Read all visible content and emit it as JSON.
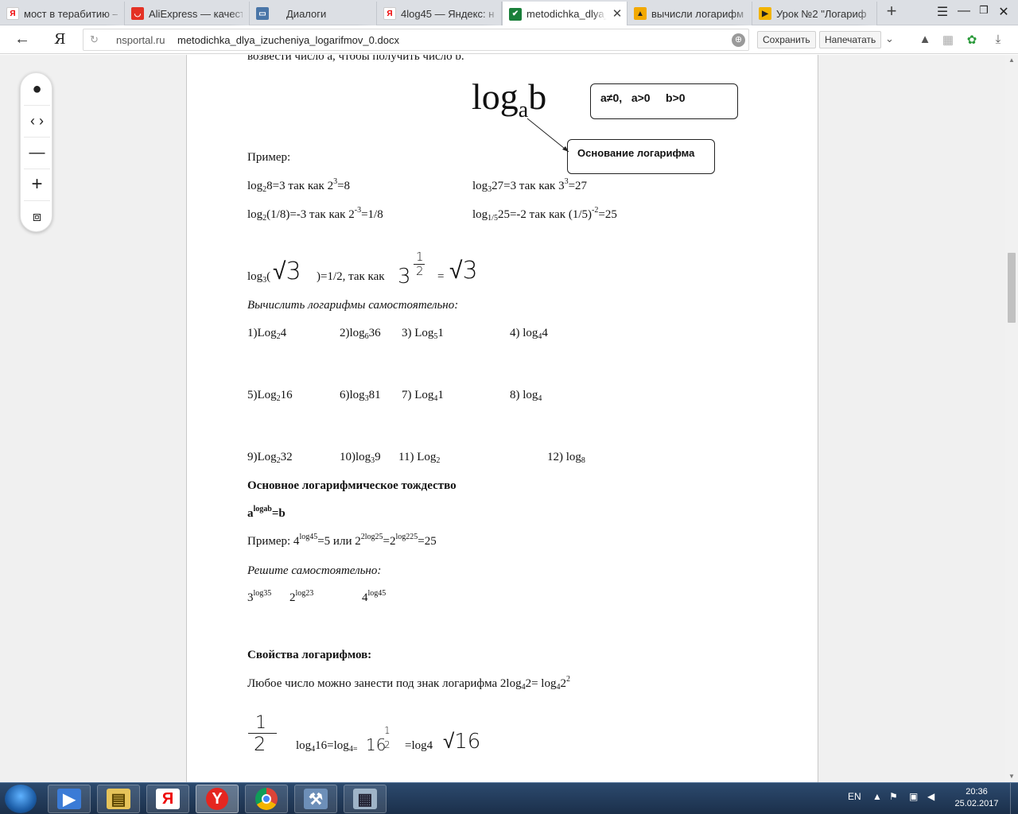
{
  "tabs": [
    {
      "title": "мост в терабитию —",
      "icon": "yandex-icon",
      "color": "#e8e8e8"
    },
    {
      "title": "AliExpress — качеств",
      "icon": "aliexpress-icon",
      "color": "#e43225"
    },
    {
      "title": "Диалоги",
      "icon": "chat-icon",
      "color": "#4a76a8"
    },
    {
      "title": "4log45 — Яндекс: на",
      "icon": "yandex-icon",
      "color": "#e8e8e8"
    },
    {
      "title": "metodichka_dlya_i",
      "icon": "check-icon",
      "color": "#1a7f3a",
      "active": true
    },
    {
      "title": "вычисли логарифм к",
      "icon": "image-icon",
      "color": "#f2a900"
    },
    {
      "title": "Урок №2 \"Логариф",
      "icon": "play-icon",
      "color": "#f2b400"
    }
  ],
  "address": {
    "domain": "nsportal.ru",
    "path": "metodichka_dlya_izucheniya_logarifmov_0.docx",
    "save_label": "Сохранить",
    "print_label": "Напечатать"
  },
  "doc": {
    "line_top": "возвести число a, чтобы получить число b.",
    "big_log": "log",
    "big_base": "a",
    "big_arg": "b",
    "cond_box": "a≠0,   a>0     b>0",
    "base_box": "Основание логарифма",
    "example_label": "Пример:",
    "ex1_a": {
      "log": "log",
      "base": "2",
      "rest": "8=3 так как 2",
      "exp": "3",
      "end": "=8"
    },
    "ex1_b": {
      "log": "log",
      "base": "3",
      "rest": "27=3 так как 3",
      "exp": "3",
      "end": "=27"
    },
    "ex2_a": {
      "log": "log",
      "base": "2",
      "rest": "(1/8)=-3 так как 2",
      "exp": "-3",
      "end": "=1/8"
    },
    "ex2_b": {
      "log": "log",
      "base": "1/5",
      "rest": "25=-2 так как (1/5)",
      "exp": "-2",
      "end": "=25"
    },
    "ex3": {
      "log": "log",
      "base": "3",
      "open": "(",
      "hand_root": "√3",
      "rest": ")=1/2, так как",
      "hand_three": "3",
      "hand_half_num": "1",
      "hand_half_den": "2",
      "eq": "=",
      "hand_root2": "√3"
    },
    "task_title": "Вычислить логарифмы самостоятельно:",
    "tasks_row1": [
      {
        "pre": "1)Log",
        "base": "2",
        "post": "4"
      },
      {
        "pre": "2)log",
        "base": "6",
        "post": "36"
      },
      {
        "pre": "3) Log",
        "base": "5",
        "post": "1"
      },
      {
        "pre": "4) log",
        "base": "4",
        "post": "4"
      }
    ],
    "tasks_row2": [
      {
        "pre": "5)Log",
        "base": "2",
        "post": "16"
      },
      {
        "pre": "6)log",
        "base": "3",
        "post": "81"
      },
      {
        "pre": "7) Log",
        "base": "4",
        "post": "1"
      },
      {
        "pre": "8) log",
        "base": "4",
        "post": ""
      }
    ],
    "tasks_row3": [
      {
        "pre": "9)Log",
        "base": "2",
        "post": "32"
      },
      {
        "pre": "10)log",
        "base": "3",
        "post": "9"
      },
      {
        "pre": "11) Log",
        "base": "2",
        "post": ""
      },
      {
        "pre": "12) log",
        "base": "8",
        "post": ""
      }
    ],
    "identity_title": "Основное логарифмическое тождество",
    "identity": {
      "a": "a",
      "exp": "logab",
      "end": "=b"
    },
    "ex4": {
      "pre": "Пример: 4",
      "e1": "log45",
      "mid1": "=5 или 2",
      "e2": "2log25",
      "mid2": "=2",
      "e3": "log225",
      "end": "=25"
    },
    "solve_title": "Решите самостоятельно:",
    "solve": [
      {
        "base": "3",
        "exp": "log35"
      },
      {
        "base": "2",
        "exp": "log23"
      },
      {
        "base": "4",
        "exp": "log45"
      }
    ],
    "props_title": "Свойства логарифмов:",
    "props_line": {
      "pre": "Любое число можно занести под знак логарифма 2log",
      "b1": "4",
      "mid": "2= log",
      "b2": "4",
      "post": "2",
      "exp": "2"
    },
    "last": {
      "hand_num": "1",
      "hand_den": "2",
      "pre": "log",
      "b1": "4",
      "mid": "16=log",
      "b2": "4=",
      "hand_16": "16",
      "hand_hn": "1",
      "hand_hd": "2",
      "eq": "=log4",
      "hand_root": "√16"
    }
  },
  "taskbar": {
    "lang": "EN",
    "time": "20:36",
    "date": "25.02.2017"
  }
}
